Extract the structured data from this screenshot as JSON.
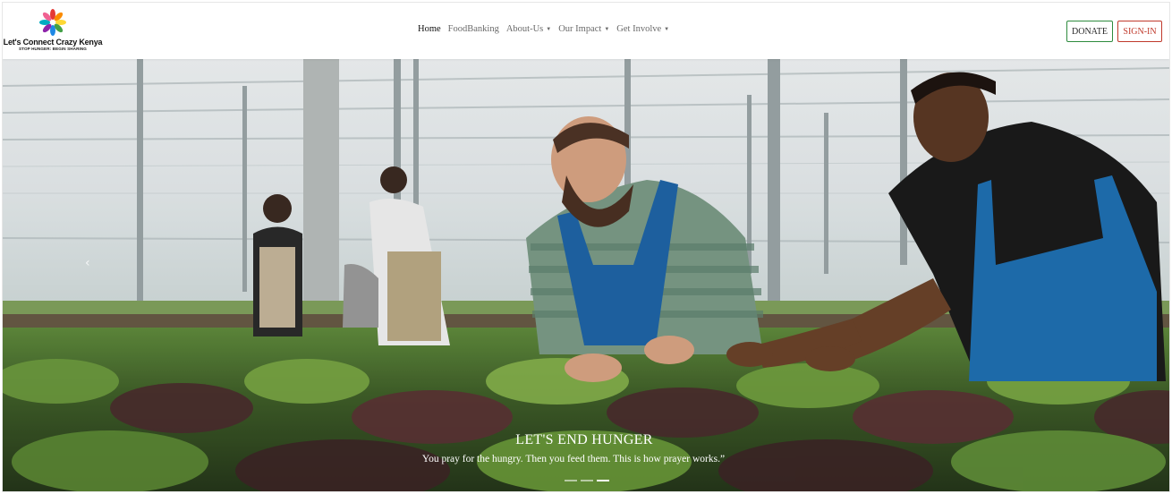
{
  "brand": {
    "name": "Let's Connect Crazy Kenya",
    "tagline": "STOP HUNGER: BEGIN SHARING",
    "logo_icon": "hands-circle-logo"
  },
  "nav": {
    "items": [
      {
        "label": "Home",
        "active": true,
        "dropdown": false
      },
      {
        "label": "FoodBanking",
        "active": false,
        "dropdown": false
      },
      {
        "label": "About-Us",
        "active": false,
        "dropdown": true
      },
      {
        "label": "Our Impact",
        "active": false,
        "dropdown": true
      },
      {
        "label": "Get Involve",
        "active": false,
        "dropdown": true
      }
    ],
    "caret_icon": "caret-down-icon"
  },
  "actions": {
    "donate_label": "DONATE",
    "signin_label": "SIGN-IN"
  },
  "hero": {
    "image": "greenhouse-farmers-lettuce-photo",
    "prev_icon": "‹",
    "title": "LET'S END HUNGER",
    "subtitle": "You pray for the hungry. Then you feed them. This is how prayer works.”",
    "slides": 3,
    "active_slide": 3
  },
  "colors": {
    "donate_border": "#2e8b3e",
    "signin_border": "#c0392b"
  }
}
